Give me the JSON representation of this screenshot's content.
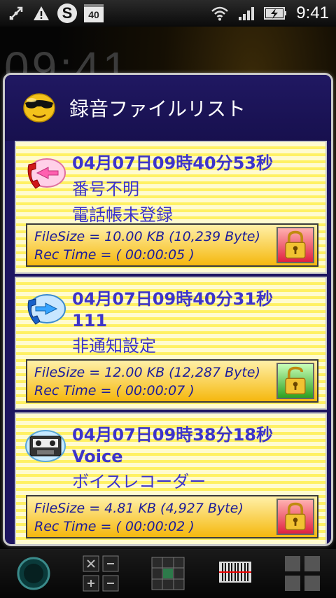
{
  "status_bar": {
    "icons": [
      "usb-debug-icon",
      "warning-icon",
      "skype-icon",
      "calendar-icon",
      "wifi-icon",
      "signal-icon",
      "battery-charging-icon"
    ],
    "skype_glyph": "S",
    "calendar_day": "40",
    "time": "9:41"
  },
  "wallpaper": {
    "clock_text": "09:41"
  },
  "dialog": {
    "title": "録音ファイルリスト",
    "title_icon": "sunglasses-smiley-icon"
  },
  "recordings": [
    {
      "datetime": "04月07日09時40分53秒",
      "line2": "番号不明",
      "line3": "電話帳未登録",
      "icon": "incoming-call-icon",
      "filesize": "FileSize = 10.00 KB (10,239 Byte)",
      "rectime": "Rec Time = ( 00:00:05 )",
      "lock": "locked-red"
    },
    {
      "datetime": "04月07日09時40分31秒",
      "line2": "111",
      "line3": "非通知設定",
      "icon": "outgoing-call-icon",
      "filesize": "FileSize = 12.00 KB (12,287 Byte)",
      "rectime": "Rec Time = ( 00:00:07 )",
      "lock": "unlocked-green"
    },
    {
      "datetime": "04月07日09時38分18秒",
      "line2": "Voice",
      "line3": "ボイスレコーダー",
      "icon": "cassette-tape-icon",
      "filesize": "FileSize = 4.81 KB (4,927 Byte)",
      "rectime": "Rec Time = ( 00:00:02 )",
      "lock": "locked-red"
    }
  ],
  "colors": {
    "dialog_bg": "#1d1560",
    "text_blue": "#3d34c9",
    "card_yellow": "#fff163",
    "lock_red": "#e02040",
    "lock_green": "#2ea020"
  }
}
